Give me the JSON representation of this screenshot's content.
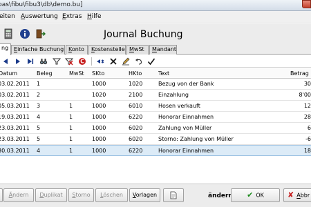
{
  "window": {
    "title": "pas\\fibu\\fibu3\\db\\demo.bu]"
  },
  "menu": [
    {
      "label": "eiten",
      "key": ""
    },
    {
      "label": "uswertung",
      "key": "A"
    },
    {
      "label": "xtras",
      "key": "E"
    },
    {
      "label": "ilfe",
      "key": "H"
    }
  ],
  "toolbar": {
    "heading": "Journal Buchung"
  },
  "tabs": [
    {
      "label": "ng",
      "key": ""
    },
    {
      "label": "infache Buchung",
      "key": "E"
    },
    {
      "label": "onto",
      "key": "K"
    },
    {
      "label": "ostenstelle",
      "key": "K"
    },
    {
      "label": "wSt",
      "key": "M"
    },
    {
      "label": "andant",
      "key": "M"
    }
  ],
  "grid": {
    "columns": [
      "Datum",
      "Beleg",
      "MwSt",
      "SKto",
      "HKto",
      "Text",
      "Betrag"
    ],
    "rows": [
      {
        "datum": "03.02.2011",
        "beleg": "1",
        "mwst": "",
        "skto": "1000",
        "hkto": "1020",
        "text": "Bezug von der Bank",
        "betrag": "30"
      },
      {
        "datum": "03.02.2011",
        "beleg": "2",
        "mwst": "",
        "skto": "1020",
        "hkto": "2100",
        "text": "Einzahlung",
        "betrag": "8'00"
      },
      {
        "datum": "05.03.2011",
        "beleg": "3",
        "mwst": "1",
        "skto": "1000",
        "hkto": "6010",
        "text": "Hosen verkauft",
        "betrag": "12"
      },
      {
        "datum": "19.03.2011",
        "beleg": "4",
        "mwst": "1",
        "skto": "1000",
        "hkto": "6220",
        "text": "Honorar Einnahmen",
        "betrag": "28"
      },
      {
        "datum": "23.03.2011",
        "beleg": "5",
        "mwst": "1",
        "skto": "1000",
        "hkto": "6020",
        "text": "Zahlung von Müller",
        "betrag": "6"
      },
      {
        "datum": "23.03.2011",
        "beleg": "5",
        "mwst": "1",
        "skto": "1000",
        "hkto": "6020",
        "text": "Storno: Zahlung von Müller",
        "betrag": "-6"
      },
      {
        "datum": "30.03.2011",
        "beleg": "4",
        "mwst": "1",
        "skto": "1000",
        "hkto": "6220",
        "text": "Honorar Einnahmen",
        "betrag": "18"
      }
    ],
    "selected_row": 6
  },
  "footer": {
    "aendern_btn": {
      "pre": "",
      "key": "Ä",
      "post": "ndern"
    },
    "duplikat_btn": {
      "pre": "",
      "key": "D",
      "post": "uplikat"
    },
    "storno_btn": {
      "pre": "",
      "key": "S",
      "post": "torno"
    },
    "loeschen_btn": {
      "pre": "",
      "key": "L",
      "post": "öschen"
    },
    "vorlagen_btn": {
      "pre": "",
      "key": "V",
      "post": "orlagen"
    },
    "status_label": "ändern:",
    "ok_btn": "OK",
    "abbrechen_btn": {
      "pre": "",
      "key": "A",
      "post": "bbr"
    }
  }
}
